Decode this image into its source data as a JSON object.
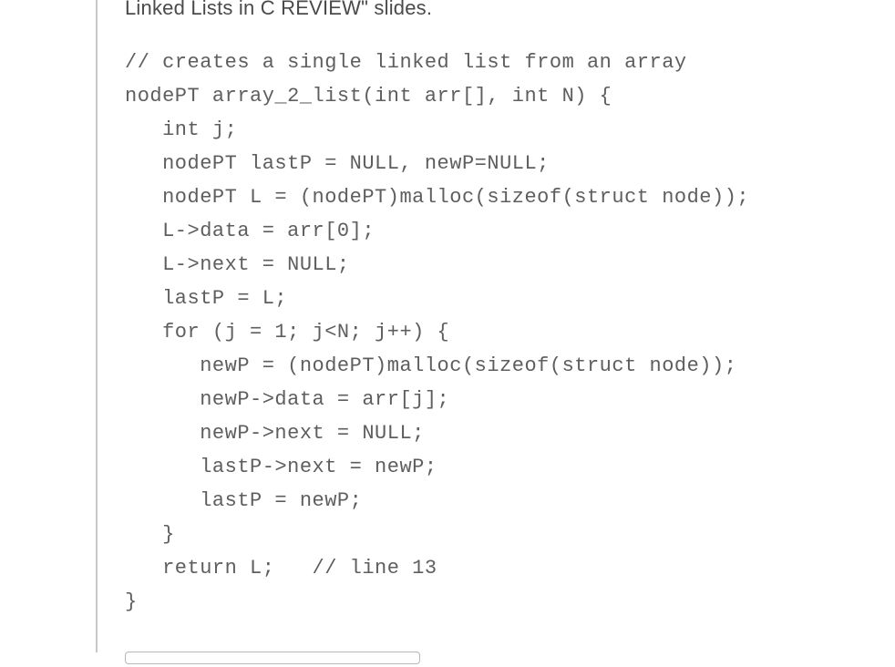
{
  "context": {
    "partial_line": "Linked Lists in C REVIEW\" slides."
  },
  "code": {
    "lines": [
      "// creates a single linked list from an array",
      "nodePT array_2_list(int arr[], int N) {",
      "   int j;",
      "   nodePT lastP = NULL, newP=NULL;",
      "   nodePT L = (nodePT)malloc(sizeof(struct node));",
      "   L->data = arr[0];",
      "   L->next = NULL;",
      "   lastP = L;",
      "   for (j = 1; j<N; j++) {",
      "      newP = (nodePT)malloc(sizeof(struct node));",
      "      newP->data = arr[j];",
      "      newP->next = NULL;",
      "      lastP->next = newP;",
      "      lastP = newP;",
      "   }",
      "   return L;   // line 13",
      "}"
    ]
  },
  "answer": {
    "value": ""
  }
}
